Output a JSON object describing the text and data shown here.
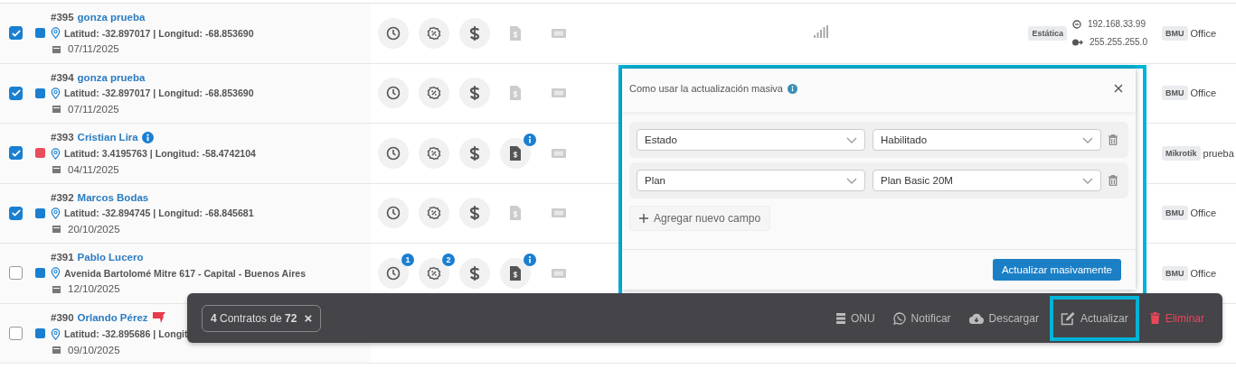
{
  "rows": [
    {
      "id": "#395",
      "name": "gonza prueba",
      "name_info": false,
      "flag": false,
      "checked": true,
      "color": "#1a7fd1",
      "location": "Latitud: -32.897017 | Longitud: -68.853690",
      "date": "07/11/2025",
      "icons": true,
      "invoice_enabled": false,
      "invoice_info": false,
      "signal": true,
      "ip_type": "Estática",
      "ip": "192.168.33.99",
      "mask": "255.255.255.0",
      "brand": "BMU",
      "device": "Office"
    },
    {
      "id": "#394",
      "name": "gonza prueba",
      "name_info": false,
      "flag": false,
      "checked": true,
      "color": "#1a7fd1",
      "location": "Latitud: -32.897017 | Longitud: -68.853690",
      "date": "07/11/2025",
      "icons": true,
      "invoice_enabled": false,
      "invoice_info": false,
      "brand": "BMU",
      "device": "Office"
    },
    {
      "id": "#393",
      "name": "Cristian Lira",
      "name_info": true,
      "flag": false,
      "checked": true,
      "color": "#e94e5d",
      "location": "Latitud: 3.4195763 | Longitud: -58.4742104",
      "date": "04/11/2025",
      "icons": true,
      "invoice_enabled": true,
      "invoice_info": true,
      "brand": "Mikrotik",
      "device": "prueba"
    },
    {
      "id": "#392",
      "name": "Marcos Bodas",
      "name_info": false,
      "flag": false,
      "checked": true,
      "color": "#1a7fd1",
      "location": "Latitud: -32.894745 | Longitud: -68.845681",
      "date": "20/10/2025",
      "icons": true,
      "invoice_enabled": false,
      "invoice_info": false,
      "brand": "BMU",
      "device": "Office"
    },
    {
      "id": "#391",
      "name": "Pablo Lucero",
      "name_info": false,
      "flag": false,
      "checked": false,
      "color": "#1a7fd1",
      "location": "Avenida Bartolomé Mitre 617 - Capital - Buenos Aires",
      "date": "12/10/2025",
      "icons": true,
      "schedule_badge": "1",
      "discount_badge": "2",
      "invoice_enabled": true,
      "invoice_info": true,
      "brand": "BMU",
      "device": "Office"
    },
    {
      "id": "#390",
      "name": "Orlando Pérez",
      "name_info": false,
      "flag": true,
      "checked": false,
      "color": "#1a7fd1",
      "location": "Latitud: -32.895686 | Longit",
      "date": "09/10/2025",
      "icons": false
    }
  ],
  "popup": {
    "title": "Como usar la actualización masiva",
    "fields": [
      {
        "field": "Estado",
        "value": "Habilitado"
      },
      {
        "field": "Plan",
        "value": "Plan Basic 20M"
      }
    ],
    "add_label": "Agregar nuevo campo",
    "submit": "Actualizar masivamente"
  },
  "bar": {
    "selection": "**4** Contratos de **72**",
    "close": "×",
    "actions": [
      {
        "kind": "onu",
        "label": "ONU",
        "highlighted": false
      },
      {
        "kind": "notify",
        "label": "Notificar",
        "highlighted": false
      },
      {
        "kind": "download",
        "label": "Descargar",
        "highlighted": false
      },
      {
        "kind": "edit",
        "label": "Actualizar",
        "highlighted": true
      },
      {
        "kind": "delete",
        "label": "Eliminar",
        "highlighted": false
      }
    ]
  }
}
